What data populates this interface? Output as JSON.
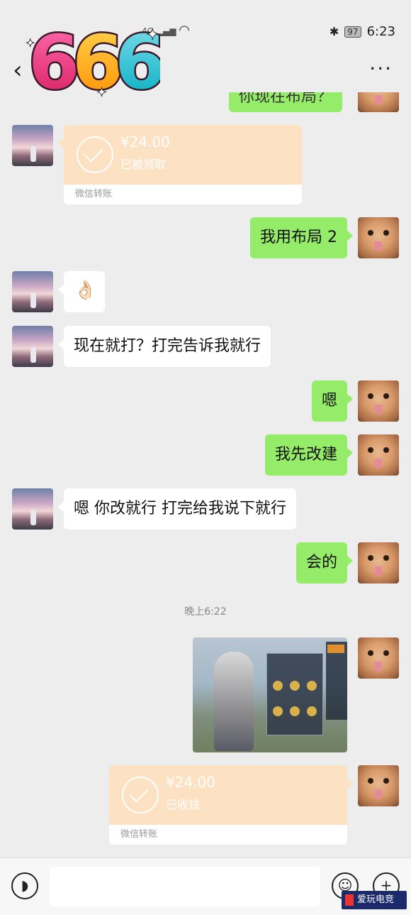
{
  "status_bar": {
    "network": "4G",
    "battery": "97",
    "time": "6:23"
  },
  "header": {
    "back_icon": "chevron-left-icon",
    "more_label": "···"
  },
  "logo_text": "666",
  "messages": [
    {
      "side": "right",
      "text": "你现在布局？",
      "partial": true
    },
    {
      "side": "left",
      "type": "transfer",
      "amount": "¥24.00",
      "status": "已被领取",
      "footer": "微信转账"
    },
    {
      "side": "right",
      "text": "我用布局 2"
    },
    {
      "side": "left",
      "type": "emoji",
      "text": "👌🏻"
    },
    {
      "side": "left",
      "text": "现在就打？打完告诉我就行"
    },
    {
      "side": "right",
      "text": "嗯"
    },
    {
      "side": "right",
      "text": "我先改建"
    },
    {
      "side": "left",
      "text": "嗯 你改就行 打完给我说下就行"
    },
    {
      "side": "right",
      "text": "会的"
    },
    {
      "type": "timestamp",
      "text": "晚上6:22"
    },
    {
      "side": "right",
      "type": "image",
      "alt": "game screenshot"
    },
    {
      "side": "right",
      "type": "transfer",
      "amount": "¥24.00",
      "status": "已收钱",
      "footer": "微信转账"
    }
  ],
  "watermark": "爱玩电竞",
  "colors": {
    "background": "#ededed",
    "self_bubble": "#95ec69",
    "other_bubble": "#ffffff",
    "transfer": "#fde1c3"
  }
}
